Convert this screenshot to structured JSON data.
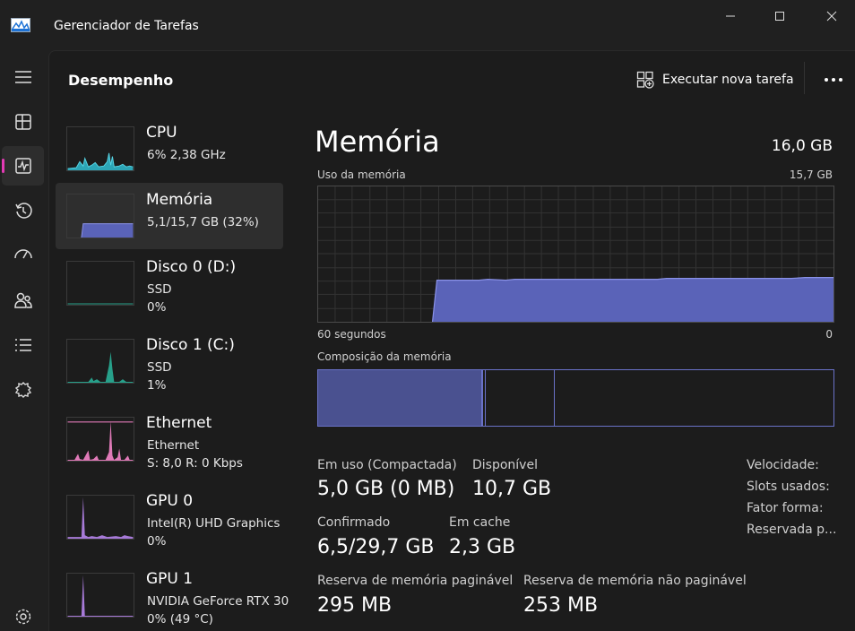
{
  "window": {
    "title": "Gerenciador de Tarefas"
  },
  "header": {
    "page_title": "Desempenho",
    "run_task_label": "Executar nova tarefa"
  },
  "nav": {
    "items": [
      {
        "name": "menu-icon"
      },
      {
        "name": "processes-icon"
      },
      {
        "name": "performance-icon",
        "active": true
      },
      {
        "name": "app-history-icon"
      },
      {
        "name": "startup-apps-icon"
      },
      {
        "name": "users-icon"
      },
      {
        "name": "details-icon"
      },
      {
        "name": "services-icon"
      },
      {
        "name": "settings-icon"
      }
    ]
  },
  "sidebar": {
    "items": [
      {
        "title": "CPU",
        "line1": "6%  2,38 GHz",
        "line2": "",
        "color": "#2fb5c8"
      },
      {
        "title": "Memória",
        "line1": "5,1/15,7 GB (32%)",
        "line2": "",
        "color": "#6a72c8"
      },
      {
        "title": "Disco 0 (D:)",
        "line1": "SSD",
        "line2": "0%",
        "color": "#27a08a"
      },
      {
        "title": "Disco 1 (C:)",
        "line1": "SSD",
        "line2": "1%",
        "color": "#27a08a"
      },
      {
        "title": "Ethernet",
        "line1": "Ethernet",
        "line2": "S: 8,0  R: 0 Kbps",
        "color": "#e07ab8"
      },
      {
        "title": "GPU 0",
        "line1": "Intel(R) UHD Graphics",
        "line2": "0%",
        "color": "#a77ad8"
      },
      {
        "title": "GPU 1",
        "line1": "NVIDIA GeForce RTX 30",
        "line2": "0% (49 °C)",
        "color": "#a77ad8"
      }
    ]
  },
  "detail": {
    "title": "Memória",
    "total": "16,0 GB",
    "usage_label": "Uso da memória",
    "usage_max": "15,7 GB",
    "time_label": "60 segundos",
    "time_end": "0",
    "composition_label": "Composição da memória",
    "stats": {
      "in_use_label": "Em uso (Compactada)",
      "in_use_value": "5,0 GB (0 MB)",
      "available_label": "Disponível",
      "available_value": "10,7 GB",
      "committed_label": "Confirmado",
      "committed_value": "6,5/29,7 GB",
      "cached_label": "Em cache",
      "cached_value": "2,3 GB",
      "paged_label": "Reserva de memória paginável",
      "paged_value": "295 MB",
      "nonpaged_label": "Reserva de memória não paginável",
      "nonpaged_value": "253 MB"
    },
    "right_stats": {
      "speed_label": "Velocidade:",
      "slots_label": "Slots usados:",
      "form_label": "Fator forma:",
      "reserved_label": "Reservada p..."
    }
  },
  "colors": {
    "accent": "#e33ab5",
    "memory": "#6a72c8",
    "memory_fill": "#5a63b8"
  }
}
